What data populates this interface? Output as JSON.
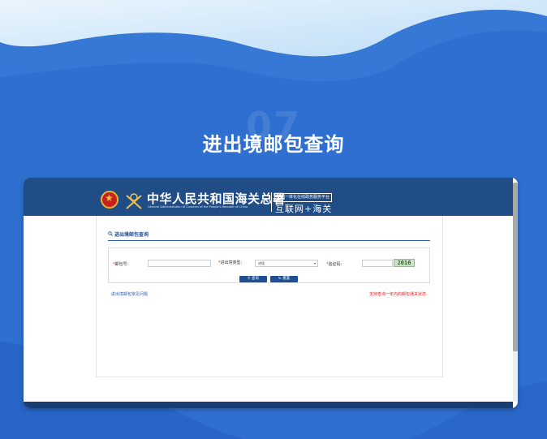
{
  "section_number": "07",
  "page_title": "进出境邮包查询",
  "site": {
    "name_cn": "中华人民共和国海关总署",
    "name_en": "General Administration of Customs of the People's Republic of China",
    "platform_label": "全国一体化在线政务服务平台",
    "platform_name": "互联网+海关"
  },
  "panel": {
    "title": "进出境邮包查询"
  },
  "form": {
    "postal_no_label": "邮包号:",
    "entry_exit_label": "进出境类型:",
    "entry_exit_value": "进境",
    "captcha_label": "验证码:",
    "captcha_text": "2016",
    "query_button": "查询",
    "reset_button": "重置"
  },
  "links": {
    "help": "进出境邮包常见问题",
    "note": "支持查询一年内的邮包通关状态"
  },
  "colors": {
    "background": "#2f6fd0",
    "banner": "#214d86",
    "accent": "#1e4f93",
    "warning": "#d9231c"
  },
  "icons": {
    "query": "search-icon",
    "reset": "reset-icon"
  }
}
